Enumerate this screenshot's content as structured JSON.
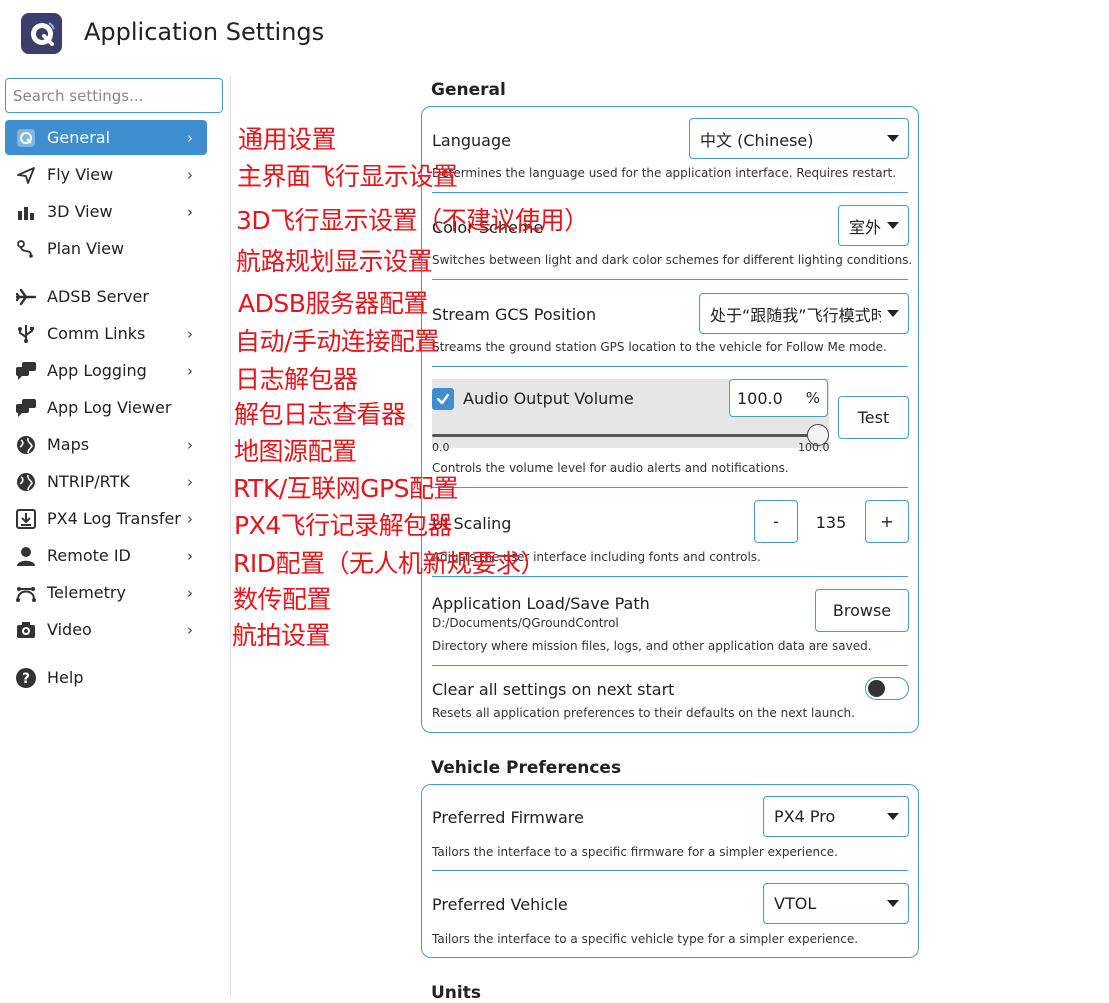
{
  "header": {
    "title": "Application Settings",
    "logo_icon": "qgc-logo-icon"
  },
  "search": {
    "placeholder": "Search settings..."
  },
  "sidebar": {
    "items": [
      {
        "label": "General",
        "icon": "general-icon",
        "chevron": true,
        "active": true
      },
      {
        "label": "Fly View",
        "icon": "fly-view-icon",
        "chevron": true
      },
      {
        "label": "3D View",
        "icon": "3d-view-icon",
        "chevron": true
      },
      {
        "label": "Plan View",
        "icon": "plan-view-icon",
        "chevron": false
      },
      {
        "label": "ADSB Server",
        "icon": "airplane-icon",
        "chevron": false
      },
      {
        "label": "Comm Links",
        "icon": "usb-icon",
        "chevron": true
      },
      {
        "label": "App Logging",
        "icon": "chat-icon",
        "chevron": true
      },
      {
        "label": "App Log Viewer",
        "icon": "chat-icon",
        "chevron": false
      },
      {
        "label": "Maps",
        "icon": "globe-icon",
        "chevron": true
      },
      {
        "label": "NTRIP/RTK",
        "icon": "globe-icon",
        "chevron": true
      },
      {
        "label": "PX4 Log Transfer",
        "icon": "download-icon",
        "chevron": true
      },
      {
        "label": "Remote ID",
        "icon": "person-icon",
        "chevron": true
      },
      {
        "label": "Telemetry",
        "icon": "telemetry-icon",
        "chevron": true
      },
      {
        "label": "Video",
        "icon": "camera-icon",
        "chevron": true
      },
      {
        "label": "Help",
        "icon": "help-icon",
        "chevron": false
      }
    ]
  },
  "annotations": [
    "通用设置",
    "主界面飞行显示设置",
    "3D飞行显示设置（不建议使用）",
    "航路规划显示设置",
    "ADSB服务器配置",
    "自动/手动连接配置",
    "日志解包器",
    "解包日志查看器",
    "地图源配置",
    "RTK/互联网GPS配置",
    "PX4飞行记录解包器",
    "RID配置（无人机新规要求）",
    "数传配置",
    "航拍设置"
  ],
  "general": {
    "title": "General",
    "language": {
      "label": "Language",
      "value": "中文 (Chinese)",
      "desc": "Determines the language used for the application interface. Requires restart."
    },
    "color_scheme": {
      "label": "Color Scheme",
      "value": "室外",
      "desc": "Switches between light and dark color schemes for different lighting conditions."
    },
    "stream_gcs": {
      "label": "Stream GCS Position",
      "value": "处于“跟随我”飞行模式时",
      "desc": "Streams the ground station GPS location to the vehicle for Follow Me mode."
    },
    "audio": {
      "label": "Audio Output Volume",
      "checked": true,
      "value": "100.0",
      "unit": "%",
      "test_label": "Test",
      "slider_min": "0.0",
      "slider_max": "100.0",
      "level_fraction": 1.0,
      "desc": "Controls the volume level for audio alerts and notifications."
    },
    "ui_scaling": {
      "label": "UI Scaling",
      "minus": "-",
      "value": "135",
      "plus": "+",
      "desc": "Adjusts the user interface including fonts and controls."
    },
    "load_save": {
      "label": "Application Load/Save Path",
      "path": "D:/Documents/QGroundControl",
      "button": "Browse",
      "desc": "Directory where mission files, logs, and other application data are saved."
    },
    "clear_settings": {
      "label": "Clear all settings on next start",
      "enabled": false,
      "desc": "Resets all application preferences to their defaults on the next launch."
    }
  },
  "vehicle": {
    "title": "Vehicle Preferences",
    "firmware": {
      "label": "Preferred Firmware",
      "value": "PX4 Pro",
      "desc": "Tailors the interface to a specific firmware for a simpler experience."
    },
    "vehicle_type": {
      "label": "Preferred Vehicle",
      "value": "VTOL",
      "desc": "Tailors the interface to a specific vehicle type for a simpler experience."
    }
  },
  "units": {
    "title": "Units"
  },
  "colors": {
    "accent": "#3f8fd0",
    "border": "#4a9cc6",
    "annotation": "#e8141c"
  }
}
